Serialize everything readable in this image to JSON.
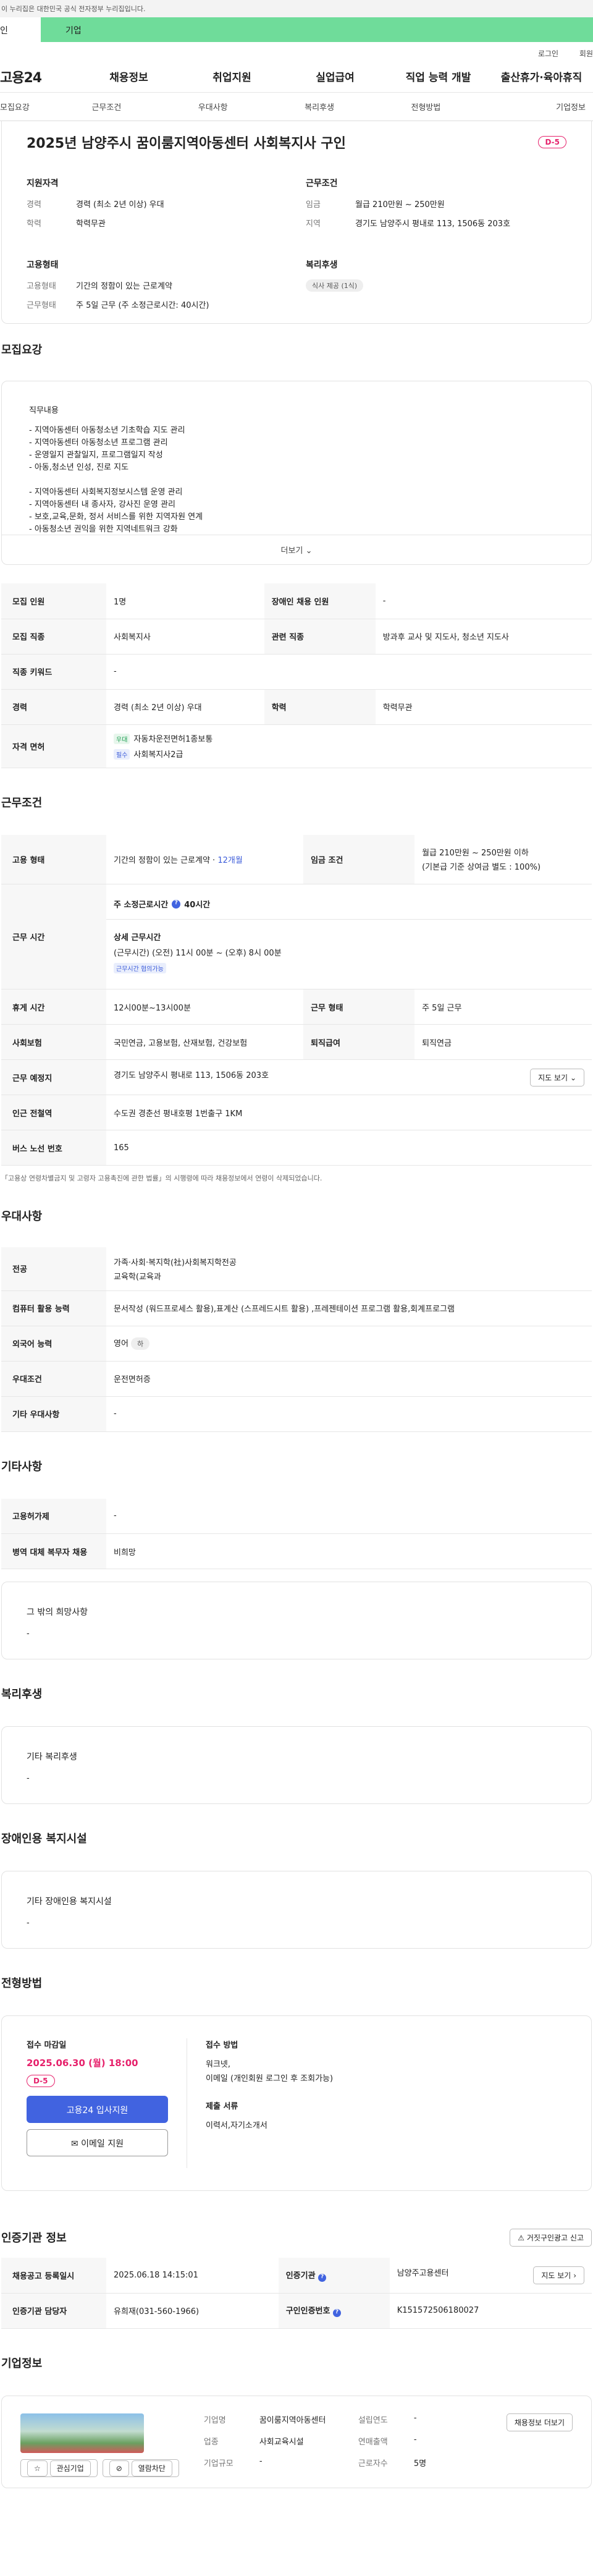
{
  "gov_banner": "이 누리집은 대한민국 공식 전자정부 누리집입니다.",
  "user_tabs": {
    "individual": "인",
    "enterprise": "기업"
  },
  "util": {
    "login": "로그인",
    "signup": "회원"
  },
  "gnb": {
    "logo": "고용24",
    "items": [
      "채용정보",
      "취업지원",
      "실업급여",
      "직업 능력 개발",
      "출산휴가·육아휴직"
    ]
  },
  "anchors": [
    "모집요강",
    "근무조건",
    "우대사항",
    "복리후생",
    "전형방법",
    "기업정보"
  ],
  "summary": {
    "title": "2025년 남양주시 꿈이룸지역아동센터 사회복지사 구인",
    "dday": "D-5",
    "qual": {
      "title": "지원자격",
      "career_k": "경력",
      "career_v": "경력 (최소 2년 이상) 우대",
      "edu_k": "학력",
      "edu_v": "학력무관"
    },
    "cond": {
      "title": "근무조건",
      "wage_k": "임금",
      "wage_v": "월급 210만원 ~ 250만원",
      "loc_k": "지역",
      "loc_v": "경기도 남양주시 평내로 113, 1506동 203호"
    },
    "emp": {
      "title": "고용형태",
      "type_k": "고용형태",
      "type_v": "기간의 정함이 있는 근로계약",
      "form_k": "근무형태",
      "form_v": "주 5일 근무 (주 소정근로시간: 40시간)"
    },
    "welfare": {
      "title": "복리후생",
      "meal": "식사 제공 (1식)"
    }
  },
  "recruit": {
    "title": "모집요강",
    "detail_title": "직무내용",
    "lines": [
      "- 지역아동센터 아동청소년 기초학습 지도 관리",
      "- 지역아동센터 아동청소년 프로그램 관리",
      "- 운영일지 관찰일지, 프로그램일지 작성",
      "- 아동,청소년 인성, 진로 지도",
      "",
      "- 지역아동센터 사회복지정보시스템 운영 관리",
      "- 지역아동센터 내 종사자, 강사진 운영 관리",
      "- 보호,교육,문화, 정서 서비스를 위한 지역자원 연계",
      "- 아동청소년 권익을 위한 지역네트워크 강화"
    ],
    "more": "더보기",
    "rows": {
      "headcount_k": "모집 인원",
      "headcount_v": "1명",
      "disabled_k": "장애인 채용 인원",
      "disabled_v": "-",
      "job_k": "모집 직종",
      "job_v": "사회복지사",
      "related_k": "관련 직종",
      "related_v": "방과후 교사 및 지도사, 청소년 지도사",
      "keyword_k": "직종 키워드",
      "keyword_v": "-",
      "career_k": "경력",
      "career_v": "경력 (최소 2년 이상) 우대",
      "edu_k": "학력",
      "edu_v": "학력무관",
      "cert_k": "자격 면허",
      "cert1_tag": "우대",
      "cert1": "자동차운전면허1종보통",
      "cert2_tag": "필수",
      "cert2": "사회복지사2급"
    }
  },
  "work": {
    "title": "근무조건",
    "emp_k": "고용 형태",
    "emp_v": "기간의 정함이 있는 근로계약",
    "emp_period": "12개월",
    "wage_k": "임금 조건",
    "wage_v": "월급 210만원 ~ 250만원 이하",
    "wage_note": "(기본급 기준 상여금 별도 : 100%)",
    "hours_k": "근무 시간",
    "hours_weekly": "주 소정근로시간",
    "hours_weekly_v": "40시간",
    "hours_detail_t": "상세 근무시간",
    "hours_detail": "(근무시간) (오전) 11시 00분 ~ (오후) 8시 00분",
    "hours_tag": "근무시간 협의가능",
    "break_k": "휴게 시간",
    "break_v": "12시00분~13시00분",
    "form_k": "근무 형태",
    "form_v": "주 5일 근무",
    "ins_k": "사회보험",
    "ins_v": "국민연금, 고용보험, 산재보험, 건강보험",
    "ret_k": "퇴직급여",
    "ret_v": "퇴직연금",
    "place_k": "근무 예정지",
    "place_v": "경기도 남양주시 평내로 113, 1506동 203호",
    "map_btn": "지도 보기",
    "subway_k": "인근 전철역",
    "subway_v": "수도권 경춘선 평내호평 1번출구 1KM",
    "bus_k": "버스 노선 번호",
    "bus_v": "165",
    "note": "「고용상 연령차별금지 및 고령자 고용촉진에 관한 법률」의 시행령에 따라 채용정보에서 연령이 삭제되었습니다."
  },
  "pref": {
    "title": "우대사항",
    "major_k": "전공",
    "major_v1": "가족·사회·복지학(社)사회복지학전공",
    "major_v2": "교육학(교육과",
    "pc_k": "컴퓨터 활용 능력",
    "pc_v": "문서작성 (워드프로세스 활용),표계산 (스프레드시트 활용) ,프레젠테이션 프로그램 활용,회계프로그램",
    "lang_k": "외국어 능력",
    "lang_v": "영어",
    "lang_tag": "하",
    "cond_k": "우대조건",
    "cond_v": "운전면허증",
    "etc_k": "기타 우대사항",
    "etc_v": "-"
  },
  "other": {
    "title": "기타사항",
    "emp_k": "고용허가제",
    "emp_v": "-",
    "mil_k": "병역 대체 복무자 채용",
    "mil_v": "비희망",
    "wish_t": "그 밖의 희망사항",
    "wish_v": "-"
  },
  "benefit": {
    "title": "복리후생",
    "box_t": "기타 복리후생",
    "box_v": "-"
  },
  "disab": {
    "title": "장애인용 복지시설",
    "box_t": "기타 장애인용 복지시설",
    "box_v": "-"
  },
  "apply": {
    "title": "전형방법",
    "deadline_t": "접수 마감일",
    "deadline_v": "2025.06.30 (월) 18:00",
    "dday": "D-5",
    "btn_apply": "고용24 입사지원",
    "btn_email": "이메일 지원",
    "method_t": "접수 방법",
    "method_v1": "워크넷,",
    "method_v2": "이메일 (개인회원 로그인 후 조회가능)",
    "docs_t": "제출 서류",
    "docs_v": "이력서,자기소개서"
  },
  "agency": {
    "title": "인증기관 정보",
    "report_btn": "거짓구인광고 신고",
    "reg_k": "채용공고 등록일시",
    "reg_v": "2025.06.18 14:15:01",
    "ag_k": "인증기관",
    "ag_v": "남양주고용센터",
    "map_btn": "지도 보기",
    "mgr_k": "인증기관 담당자",
    "mgr_v": "유희재(031-560-1966)",
    "num_k": "구인인증번호",
    "num_v": "K151572506180027"
  },
  "company": {
    "title": "기업정보",
    "fav": "관심기업",
    "block": "열람차단",
    "name_k": "기업명",
    "name_v": "꿈이룸지역아동센터",
    "ind_k": "업종",
    "ind_v": "사회교육시설",
    "size_k": "기업규모",
    "size_v": "-",
    "year_k": "설립연도",
    "year_v": "-",
    "sales_k": "연매출액",
    "sales_v": "-",
    "emp_k": "근로자수",
    "emp_v": "5명",
    "more_btn": "채용정보 더보기"
  }
}
